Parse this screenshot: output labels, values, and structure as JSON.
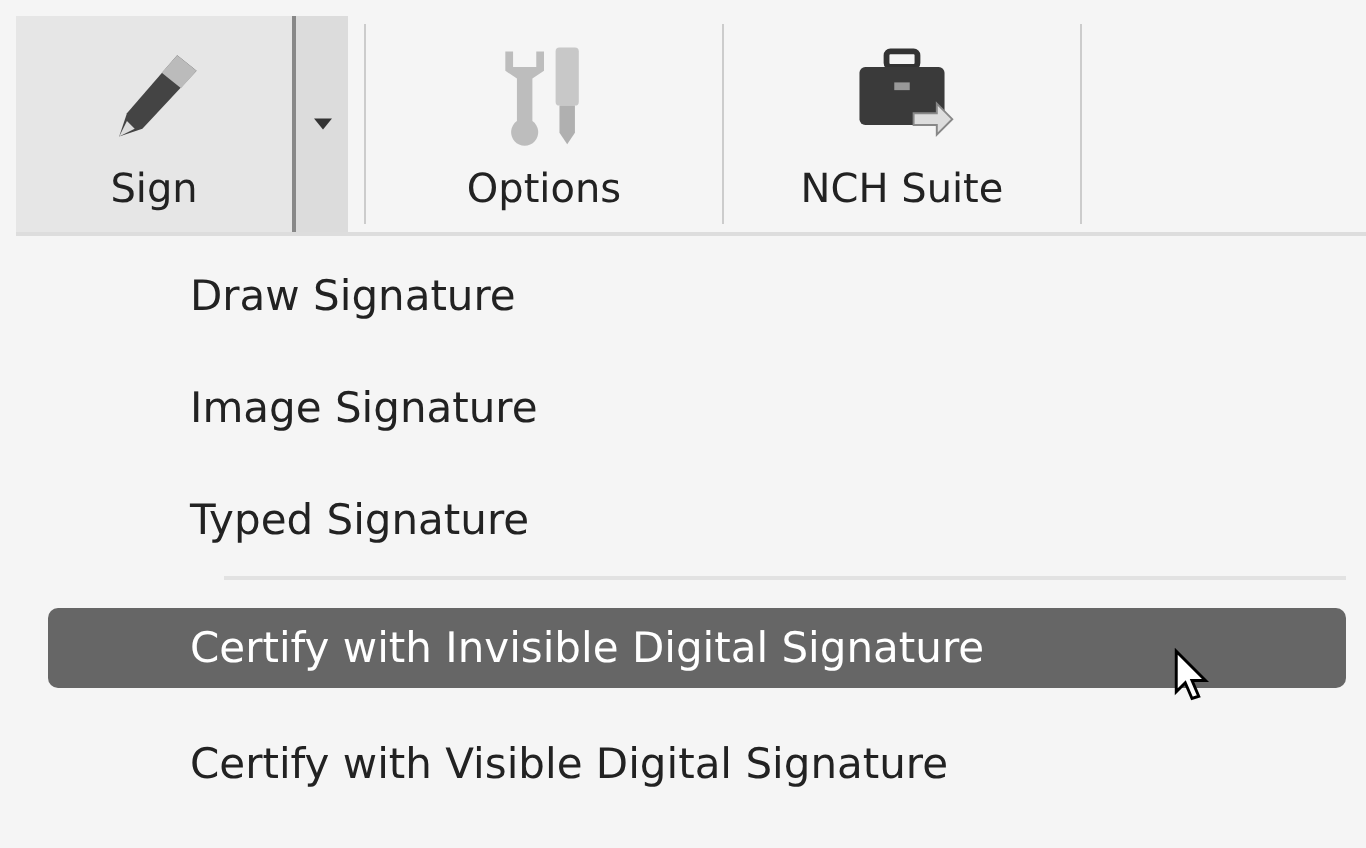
{
  "toolbar": {
    "buttons": [
      {
        "label": "Sign",
        "kind": "pen",
        "dropdown": true
      },
      {
        "label": "Options",
        "kind": "tools",
        "dropdown": false
      },
      {
        "label": "NCH Suite",
        "kind": "case",
        "dropdown": false
      }
    ]
  },
  "menu": {
    "items": [
      {
        "kind": "item",
        "label": "Draw Signature",
        "selected": false
      },
      {
        "kind": "item",
        "label": "Image Signature",
        "selected": false
      },
      {
        "kind": "item",
        "label": "Typed Signature",
        "selected": false
      },
      {
        "kind": "separator"
      },
      {
        "kind": "item",
        "label": "Certify with Invisible Digital Signature",
        "selected": true
      },
      {
        "kind": "item",
        "label": "Certify with Visible Digital Signature",
        "selected": false
      }
    ]
  }
}
